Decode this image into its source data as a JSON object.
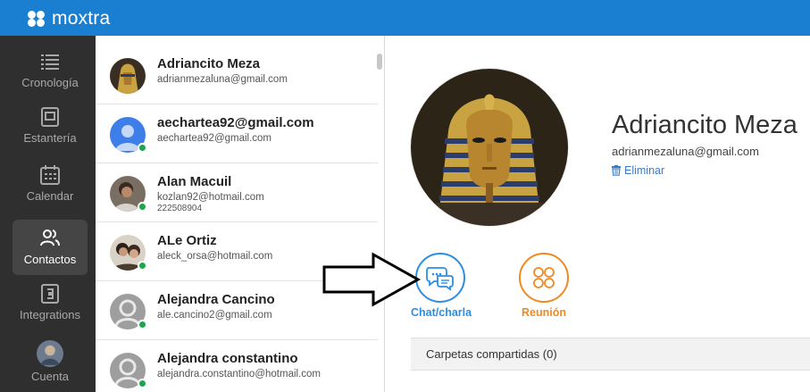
{
  "app": {
    "brand": "moxtra",
    "accent": "#1a7fd1"
  },
  "sidebar": {
    "items": [
      {
        "label": "Cronología",
        "icon": "timeline-icon",
        "active": false
      },
      {
        "label": "Estantería",
        "icon": "binder-icon",
        "active": false
      },
      {
        "label": "Calendar",
        "icon": "calendar-icon",
        "active": false
      },
      {
        "label": "Contactos",
        "icon": "contacts-icon",
        "active": true
      },
      {
        "label": "Integrations",
        "icon": "integrations-icon",
        "active": false
      },
      {
        "label": "Cuenta",
        "icon": "account-avatar",
        "active": false
      }
    ]
  },
  "contacts": [
    {
      "name": "Adriancito Meza",
      "email": "adrianmezaluna@gmail.com",
      "online": false
    },
    {
      "name": "aechartea92@gmail.com",
      "email": "aechartea92@gmail.com",
      "online": true
    },
    {
      "name": "Alan Macuil",
      "email": "kozlan92@hotmail.com",
      "phone": "222508904",
      "online": true
    },
    {
      "name": "ALe Ortiz",
      "email": "aleck_orsa@hotmail.com",
      "online": true
    },
    {
      "name": "Alejandra Cancino",
      "email": "ale.cancino2@gmail.com",
      "online": true
    },
    {
      "name": "Alejandra constantino",
      "email": "alejandra.constantino@hotmail.com",
      "online": true
    }
  ],
  "detail": {
    "name": "Adriancito Meza",
    "email": "adrianmezaluna@gmail.com",
    "delete_label": "Eliminar",
    "actions": [
      {
        "label": "Chat/charla",
        "icon": "chat-icon",
        "color": "#2d8ee0"
      },
      {
        "label": "Reunión",
        "icon": "meeting-icon",
        "color": "#ef8a22"
      }
    ],
    "shared_folders_label": "Carpetas compartidas (0)"
  }
}
